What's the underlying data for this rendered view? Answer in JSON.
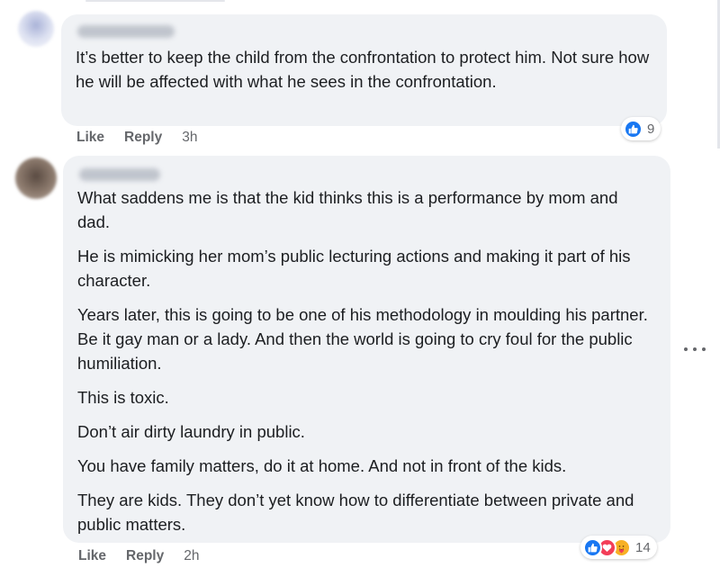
{
  "comments": [
    {
      "text": [
        "It’s better to keep the child from the confrontation to protect him. Not sure how he will be affected with what he sees in the confrontation."
      ],
      "like_label": "Like",
      "reply_label": "Reply",
      "time": "3h",
      "reaction_count": "9",
      "reaction_icons": [
        "like-icon"
      ]
    },
    {
      "text": [
        "What saddens me is that the kid thinks this is a performance by mom and dad.",
        "He is mimicking her mom’s public lecturing actions and making it part of his character.",
        "Years later, this is going to be one of his methodology in moulding his partner. Be it gay man or a lady. And then the world is going to cry foul for the public humiliation.",
        "This is toxic.",
        "Don’t air dirty laundry in public.",
        "You have family matters, do it at home. And not in front of the kids.",
        "They are kids. They don’t yet know how to differentiate between private and public matters."
      ],
      "like_label": "Like",
      "reply_label": "Reply",
      "time": "2h",
      "reaction_count": "14",
      "reaction_icons": [
        "like-icon",
        "love-icon",
        "care-icon"
      ]
    }
  ],
  "colors": {
    "bubble": "#f0f2f5",
    "meta_text": "#65676b",
    "like": "#1877f2",
    "love": "#f33e58",
    "care": "#f7b125"
  }
}
